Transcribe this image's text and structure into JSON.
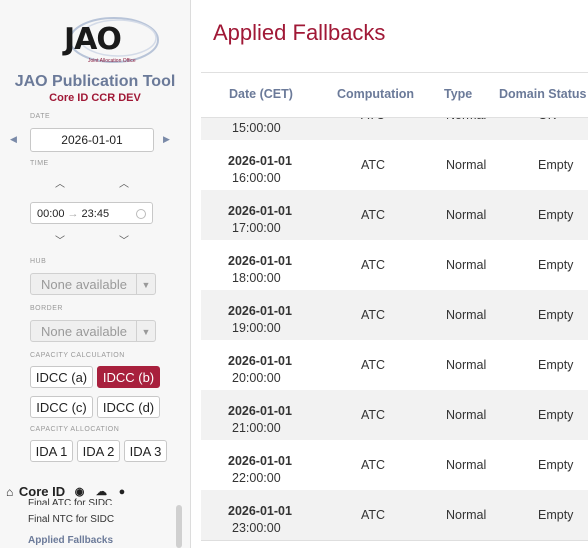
{
  "logo": {
    "text": "JAO",
    "subtext": "Joint Allocation Office"
  },
  "app": {
    "title": "JAO Publication Tool",
    "env": "Core ID CCR DEV"
  },
  "date": {
    "label": "DATE",
    "value": "2026-01-01"
  },
  "time": {
    "label": "TIME",
    "from": "00:00",
    "to": "23:45"
  },
  "hub": {
    "label": "HUB",
    "value": "None available"
  },
  "border": {
    "label": "BORDER",
    "value": "None available"
  },
  "capacity_calculation": {
    "label": "CAPACITY CALCULATION",
    "buttons": [
      "IDCC (a)",
      "IDCC (b)",
      "IDCC (c)",
      "IDCC (d)"
    ],
    "active": "IDCC (b)"
  },
  "capacity_allocation": {
    "label": "CAPACITY ALLOCATION",
    "buttons": [
      "IDA 1",
      "IDA 2",
      "IDA 3"
    ]
  },
  "nav": {
    "section": "Core ID",
    "items": [
      "Final ATC for SIDC",
      "Final NTC for SIDC",
      "Applied Fallbacks"
    ],
    "active": "Applied Fallbacks"
  },
  "page": {
    "title": "Applied Fallbacks"
  },
  "table": {
    "columns": [
      "Date (CET)",
      "Computation",
      "Type",
      "Domain Status"
    ],
    "rows": [
      {
        "date": "",
        "time": "15:00:00",
        "computation": "ATC",
        "type": "Normal",
        "status": "OK"
      },
      {
        "date": "2026-01-01",
        "time": "16:00:00",
        "computation": "ATC",
        "type": "Normal",
        "status": "Empty"
      },
      {
        "date": "2026-01-01",
        "time": "17:00:00",
        "computation": "ATC",
        "type": "Normal",
        "status": "Empty"
      },
      {
        "date": "2026-01-01",
        "time": "18:00:00",
        "computation": "ATC",
        "type": "Normal",
        "status": "Empty"
      },
      {
        "date": "2026-01-01",
        "time": "19:00:00",
        "computation": "ATC",
        "type": "Normal",
        "status": "Empty"
      },
      {
        "date": "2026-01-01",
        "time": "20:00:00",
        "computation": "ATC",
        "type": "Normal",
        "status": "Empty"
      },
      {
        "date": "2026-01-01",
        "time": "21:00:00",
        "computation": "ATC",
        "type": "Normal",
        "status": "Empty"
      },
      {
        "date": "2026-01-01",
        "time": "22:00:00",
        "computation": "ATC",
        "type": "Normal",
        "status": "Empty"
      },
      {
        "date": "2026-01-01",
        "time": "23:00:00",
        "computation": "ATC",
        "type": "Normal",
        "status": "Empty"
      }
    ]
  },
  "colors": {
    "brand": "#a01836",
    "accent": "#6b7a99",
    "active_button": "#a8203d"
  }
}
